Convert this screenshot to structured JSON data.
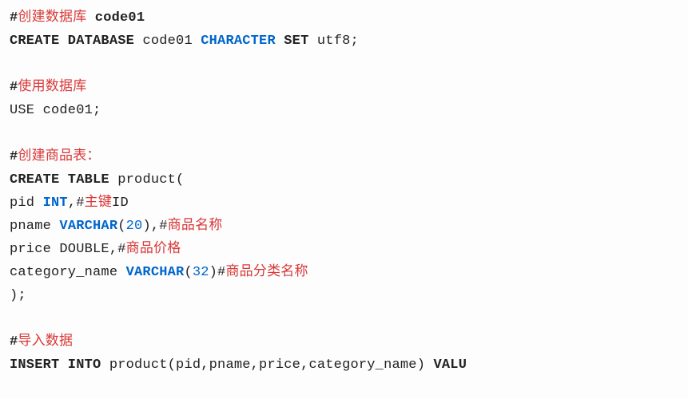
{
  "lines": [
    [
      {
        "cls": "plainb",
        "t": "#"
      },
      {
        "cls": "cmt",
        "t": "创建数据库"
      },
      {
        "cls": "plainb",
        "t": " code01"
      }
    ],
    [
      {
        "cls": "plainb",
        "t": "CREATE DATABASE "
      },
      {
        "cls": "",
        "t": "code01 "
      },
      {
        "cls": "kw",
        "t": "CHARACTER"
      },
      {
        "cls": "plainb",
        "t": " SET "
      },
      {
        "cls": "",
        "t": "utf8;"
      }
    ],
    [
      {
        "cls": "",
        "t": ""
      }
    ],
    [
      {
        "cls": "plainb",
        "t": "#"
      },
      {
        "cls": "cmt",
        "t": "使用数据库"
      }
    ],
    [
      {
        "cls": "",
        "t": "USE code01;"
      }
    ],
    [
      {
        "cls": "",
        "t": ""
      }
    ],
    [
      {
        "cls": "plainb",
        "t": "#"
      },
      {
        "cls": "cmt",
        "t": "创建商品表："
      }
    ],
    [
      {
        "cls": "plainb",
        "t": "CREATE TABLE "
      },
      {
        "cls": "",
        "t": "product("
      }
    ],
    [
      {
        "cls": "",
        "t": "pid "
      },
      {
        "cls": "kw",
        "t": "INT"
      },
      {
        "cls": "",
        "t": ",#"
      },
      {
        "cls": "cmt",
        "t": "主键"
      },
      {
        "cls": "",
        "t": "ID"
      }
    ],
    [
      {
        "cls": "",
        "t": "pname "
      },
      {
        "cls": "kw",
        "t": "VARCHAR"
      },
      {
        "cls": "",
        "t": "("
      },
      {
        "cls": "num",
        "t": "20"
      },
      {
        "cls": "",
        "t": "),#"
      },
      {
        "cls": "cmt",
        "t": "商品名称"
      }
    ],
    [
      {
        "cls": "",
        "t": "price DOUBLE,#"
      },
      {
        "cls": "cmt",
        "t": "商品价格"
      }
    ],
    [
      {
        "cls": "",
        "t": "category_name "
      },
      {
        "cls": "kw",
        "t": "VARCHAR"
      },
      {
        "cls": "",
        "t": "("
      },
      {
        "cls": "num",
        "t": "32"
      },
      {
        "cls": "",
        "t": ")#"
      },
      {
        "cls": "cmt",
        "t": "商品分类名称"
      }
    ],
    [
      {
        "cls": "",
        "t": ");"
      }
    ],
    [
      {
        "cls": "",
        "t": ""
      }
    ],
    [
      {
        "cls": "plainb",
        "t": "#"
      },
      {
        "cls": "cmt",
        "t": "导入数据"
      }
    ],
    [
      {
        "cls": "plainb",
        "t": "INSERT INTO "
      },
      {
        "cls": "",
        "t": "product(pid,pname,price,category_name) "
      },
      {
        "cls": "plainb",
        "t": "VALU"
      }
    ]
  ]
}
